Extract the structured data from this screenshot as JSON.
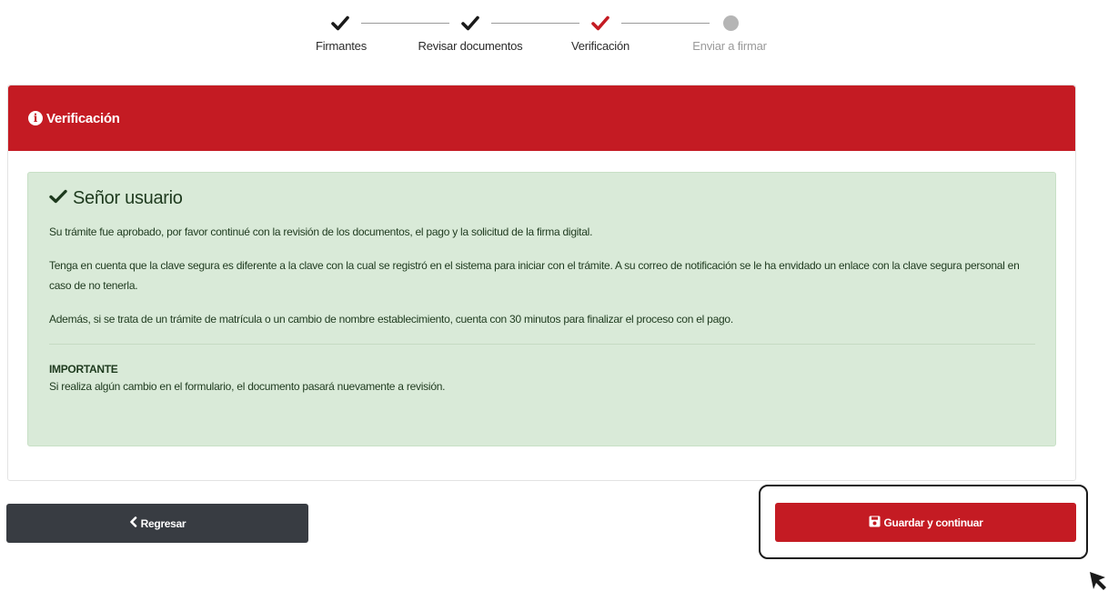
{
  "stepper": {
    "steps": [
      {
        "label": "Firmantes",
        "state": "done"
      },
      {
        "label": "Revisar documentos",
        "state": "done"
      },
      {
        "label": "Verificación",
        "state": "current"
      },
      {
        "label": "Enviar a firmar",
        "state": "pending"
      }
    ]
  },
  "card": {
    "title": "Verificación",
    "header_icon": "info-circle-icon"
  },
  "alert": {
    "heading": "Señor usuario",
    "heading_icon": "checkmark-icon",
    "p1": "Su trámite fue aprobado, por favor continué con la revisión de los documentos, el pago y la solicitud de la firma digital.",
    "p2": "Tenga en cuenta que la clave segura es diferente a la clave con la cual se registró en el sistema para iniciar con el trámite. A su correo de notificación se le ha envidado un enlace con la clave segura personal en caso de no tenerla.",
    "p3": "Además, si se trata de un trámite de matrícula o un cambio de nombre establecimiento, cuenta con 30 minutos para finalizar el proceso con el pago.",
    "important_label": "IMPORTANTE",
    "important_text": "Si realiza algún cambio en el formulario, el documento pasará nuevamente a revisión."
  },
  "buttons": {
    "back_label": "Regresar",
    "back_icon": "chevron-left-icon",
    "save_label": "Guardar y continuar",
    "save_icon": "floppy-disk-icon"
  },
  "colors": {
    "brand_red": "#c41b23",
    "dark_button": "#383c42",
    "success_bg": "#d9ead8",
    "pending_gray": "#b5b5b5"
  }
}
